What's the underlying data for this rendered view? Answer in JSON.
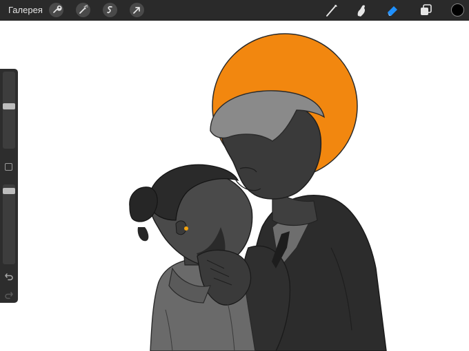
{
  "toolbar": {
    "gallery_label": "Галерея",
    "left_tools": [
      "wrench-icon",
      "magic-wand-icon",
      "selection-icon",
      "transform-arrow-icon"
    ],
    "right_tools": [
      "brush-icon",
      "smudge-icon",
      "eraser-icon",
      "layers-icon"
    ],
    "active_tool": "eraser-icon",
    "active_color": "#000000",
    "accent_color": "#1e90ff"
  },
  "sidebar": {
    "brush_size_level": 0.55,
    "opacity_level": 0.95,
    "buttons": [
      "modify-button",
      "undo-button",
      "redo-button"
    ]
  },
  "artwork": {
    "halo_color": "#f2870f",
    "ink_color": "#3a3a3a"
  }
}
